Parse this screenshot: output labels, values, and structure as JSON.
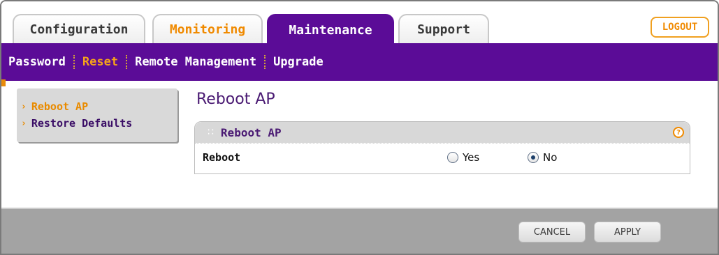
{
  "tabs": [
    {
      "label": "Configuration"
    },
    {
      "label": "Monitoring"
    },
    {
      "label": "Maintenance"
    },
    {
      "label": "Support"
    }
  ],
  "logout_label": "LOGOUT",
  "subnav": [
    {
      "label": "Password"
    },
    {
      "label": "Reset"
    },
    {
      "label": "Remote Management"
    },
    {
      "label": "Upgrade"
    }
  ],
  "left_menu": [
    {
      "label": "Reboot AP"
    },
    {
      "label": "Restore Defaults"
    }
  ],
  "page_title": "Reboot AP",
  "section": {
    "title": "Reboot AP",
    "help_icon": "?",
    "row_label": "Reboot",
    "options": [
      {
        "label": "Yes",
        "checked": false
      },
      {
        "label": "No",
        "checked": true
      }
    ]
  },
  "buttons": {
    "cancel": "CANCEL",
    "apply": "APPLY"
  },
  "colors": {
    "purple": "#5b0c97",
    "orange": "#f08a00"
  }
}
